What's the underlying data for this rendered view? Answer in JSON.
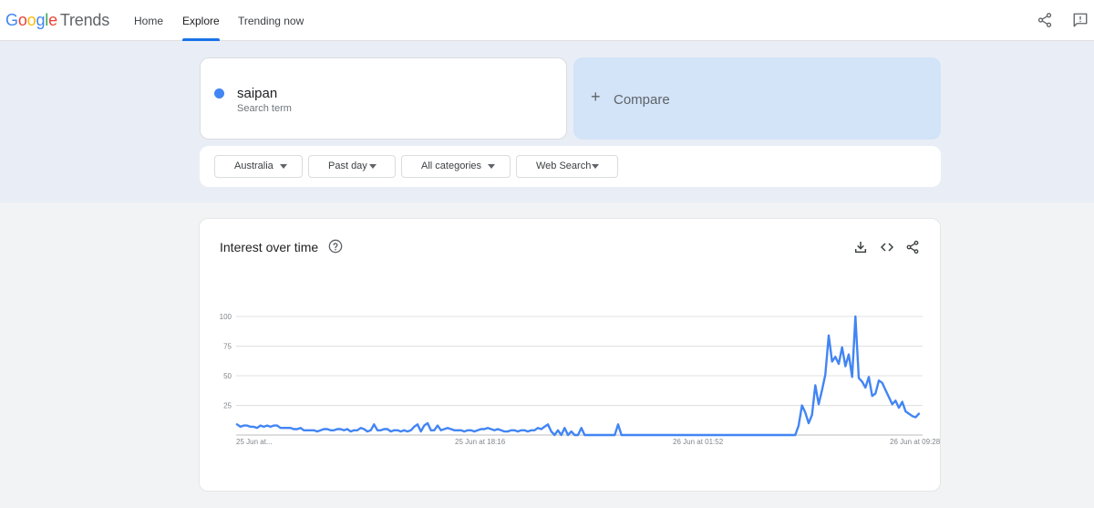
{
  "header": {
    "logo_google": "Google",
    "logo_trends": "Trends",
    "nav": {
      "home": "Home",
      "explore": "Explore",
      "trending": "Trending now"
    },
    "icons": {
      "share": "share-icon",
      "feedback": "feedback-icon"
    }
  },
  "search": {
    "term": "saipan",
    "term_type": "Search term",
    "term_color": "#4285f4",
    "compare_label": "Compare"
  },
  "filters": {
    "region": "Australia",
    "time": "Past day",
    "category": "All categories",
    "property": "Web Search"
  },
  "widget": {
    "title": "Interest over time",
    "icons": [
      "help-icon",
      "download-icon",
      "embed-icon",
      "share-icon"
    ]
  },
  "chart_data": {
    "type": "line",
    "title": "Interest over time",
    "ylim": [
      0,
      100
    ],
    "yticks": [
      "100",
      "75",
      "50",
      "25"
    ],
    "xtick_labels": [
      "25 Jun at...",
      "25 Jun at 18:16",
      "26 Jun at 01:52",
      "26 Jun at 09:28"
    ],
    "grid": true,
    "series": [
      {
        "name": "saipan",
        "color": "#4285f4",
        "values": [
          9,
          7,
          8,
          8,
          7,
          7,
          6,
          8,
          7,
          8,
          7,
          8,
          8,
          6,
          6,
          6,
          6,
          5,
          5,
          6,
          4,
          4,
          4,
          4,
          3,
          4,
          5,
          5,
          4,
          4,
          5,
          5,
          4,
          5,
          3,
          4,
          4,
          6,
          5,
          3,
          4,
          9,
          4,
          4,
          5,
          5,
          3,
          4,
          4,
          3,
          4,
          3,
          4,
          7,
          9,
          3,
          8,
          10,
          4,
          4,
          8,
          4,
          5,
          6,
          5,
          4,
          4,
          4,
          3,
          4,
          4,
          3,
          4,
          5,
          5,
          6,
          5,
          4,
          5,
          4,
          3,
          3,
          4,
          4,
          3,
          4,
          4,
          3,
          4,
          4,
          6,
          5,
          7,
          9,
          3,
          0,
          4,
          0,
          6,
          0,
          3,
          0,
          0,
          6,
          0,
          0,
          0,
          0,
          0,
          0,
          0,
          0,
          0,
          0,
          9,
          0,
          0,
          0,
          0,
          0,
          0,
          0,
          0,
          0,
          0,
          0,
          0,
          0,
          0,
          0,
          0,
          0,
          0,
          0,
          0,
          0,
          0,
          0,
          0,
          0,
          0,
          0,
          0,
          0,
          0,
          0,
          0,
          0,
          0,
          0,
          0,
          0,
          0,
          0,
          0,
          0,
          0,
          0,
          0,
          0,
          0,
          0,
          0,
          0,
          0,
          0,
          0,
          0,
          8,
          25,
          19,
          10,
          17,
          42,
          26,
          38,
          51,
          84,
          62,
          66,
          60,
          74,
          58,
          68,
          49,
          100,
          48,
          45,
          40,
          49,
          33,
          35,
          46,
          44,
          38,
          32,
          26,
          29,
          23,
          28,
          20,
          18,
          16,
          15,
          18
        ]
      }
    ]
  }
}
